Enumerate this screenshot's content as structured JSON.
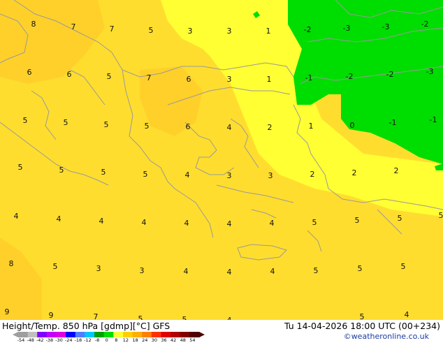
{
  "title": "Height/Temp. 850 hPa [gdmp][°C] GFS",
  "valid_time": "Tu 14-04-2026 18:00 UTC (00+234)",
  "credit": "©weatheronline.co.uk",
  "colors": {
    "warm_yellow": "#ffff33",
    "deeper_yellow": "#ffdd2e",
    "orange_yellow": "#ffd02a",
    "green": "#00dd00",
    "coast": "#9a9a9a"
  },
  "colorbar": {
    "labels": [
      "-54",
      "-48",
      "-42",
      "-38",
      "-30",
      "-24",
      "-18",
      "-12",
      "-8",
      "0",
      "8",
      "12",
      "18",
      "24",
      "30",
      "36",
      "42",
      "48",
      "54"
    ],
    "colors": [
      "#9e9e9e",
      "#c0c0c0",
      "#8000ff",
      "#c000ff",
      "#e000e0",
      "#0000ff",
      "#4f7fff",
      "#00c8ff",
      "#00a000",
      "#00dd00",
      "#ffff33",
      "#ffd000",
      "#ffb000",
      "#ff8000",
      "#ff3000",
      "#e00000",
      "#b00000",
      "#800000",
      "#500000"
    ]
  },
  "temperature_labels": [
    {
      "text": "8"
    },
    {
      "text": "7"
    },
    {
      "text": "7"
    },
    {
      "text": "5"
    },
    {
      "text": "3"
    },
    {
      "text": "3"
    },
    {
      "text": "1"
    },
    {
      "text": "-2"
    },
    {
      "text": "-3"
    },
    {
      "text": "-3"
    },
    {
      "text": "-2"
    },
    {
      "text": "6"
    },
    {
      "text": "6"
    },
    {
      "text": "5"
    },
    {
      "text": "7"
    },
    {
      "text": "6"
    },
    {
      "text": "3"
    },
    {
      "text": "1"
    },
    {
      "text": "-1"
    },
    {
      "text": "-2"
    },
    {
      "text": "-2"
    },
    {
      "text": "-3"
    },
    {
      "text": "5"
    },
    {
      "text": "5"
    },
    {
      "text": "5"
    },
    {
      "text": "5"
    },
    {
      "text": "6"
    },
    {
      "text": "4"
    },
    {
      "text": "2"
    },
    {
      "text": "1"
    },
    {
      "text": "0"
    },
    {
      "text": "-1"
    },
    {
      "text": "-1"
    },
    {
      "text": "5"
    },
    {
      "text": "5"
    },
    {
      "text": "5"
    },
    {
      "text": "5"
    },
    {
      "text": "4"
    },
    {
      "text": "3"
    },
    {
      "text": "3"
    },
    {
      "text": "2"
    },
    {
      "text": "2"
    },
    {
      "text": "2"
    },
    {
      "text": "4"
    },
    {
      "text": "4"
    },
    {
      "text": "4"
    },
    {
      "text": "4"
    },
    {
      "text": "4"
    },
    {
      "text": "4"
    },
    {
      "text": "4"
    },
    {
      "text": "5"
    },
    {
      "text": "5"
    },
    {
      "text": "5"
    },
    {
      "text": "5"
    },
    {
      "text": "8"
    },
    {
      "text": "5"
    },
    {
      "text": "3"
    },
    {
      "text": "3"
    },
    {
      "text": "4"
    },
    {
      "text": "4"
    },
    {
      "text": "4"
    },
    {
      "text": "5"
    },
    {
      "text": "5"
    },
    {
      "text": "5"
    },
    {
      "text": "9"
    },
    {
      "text": "9"
    },
    {
      "text": "7"
    },
    {
      "text": "5"
    },
    {
      "text": "5"
    },
    {
      "text": "4"
    },
    {
      "text": "5"
    },
    {
      "text": "4"
    }
  ]
}
